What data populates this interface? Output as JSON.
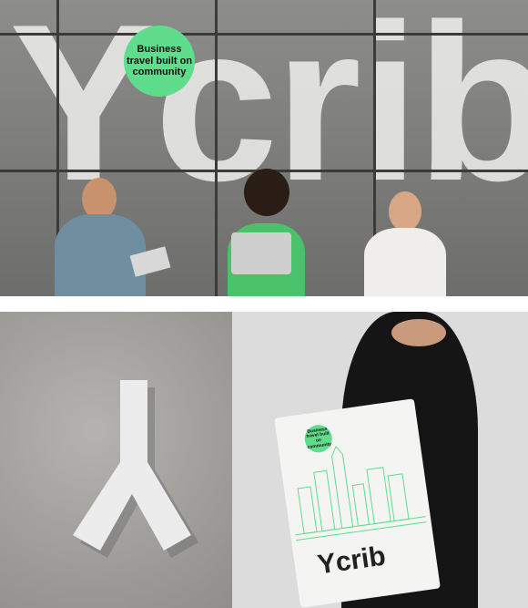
{
  "hero": {
    "wordmark": "Ycrib",
    "badge": "Business travel built on community"
  },
  "bag": {
    "wordmark": "Ycrib",
    "badge": "Business travel built on community"
  },
  "colors": {
    "brand_green": "#5fdc8c",
    "concrete": "#8a8a88"
  }
}
